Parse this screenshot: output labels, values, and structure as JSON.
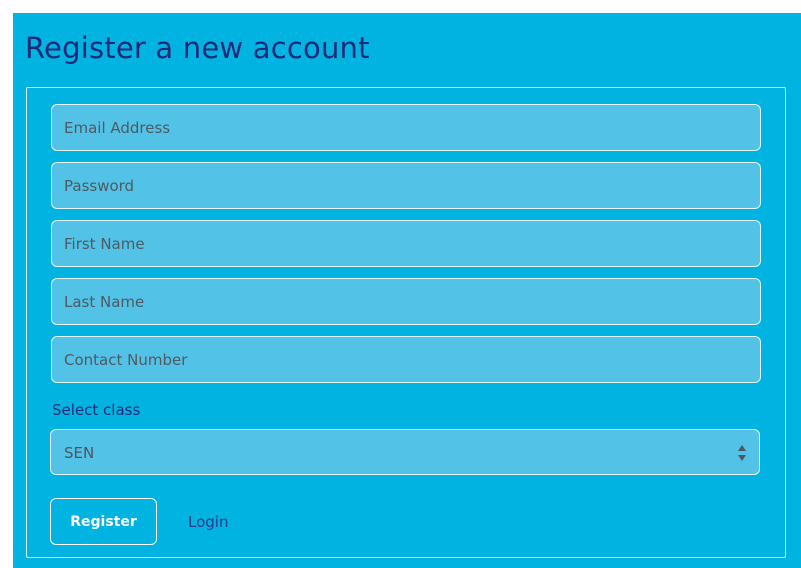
{
  "title": "Register a new account",
  "fields": {
    "email": {
      "placeholder": "Email Address",
      "value": ""
    },
    "password": {
      "placeholder": "Password",
      "value": ""
    },
    "first_name": {
      "placeholder": "First Name",
      "value": ""
    },
    "last_name": {
      "placeholder": "Last Name",
      "value": ""
    },
    "contact": {
      "placeholder": "Contact Number",
      "value": ""
    }
  },
  "class_select": {
    "label": "Select class",
    "selected": "SEN",
    "arrows_icon": "up-down-chevron-icon"
  },
  "actions": {
    "register_label": "Register",
    "login_label": "Login"
  },
  "colors": {
    "background": "#00b3e0",
    "field_fill": "#52c2e6",
    "title_text": "#1d2a7a"
  }
}
